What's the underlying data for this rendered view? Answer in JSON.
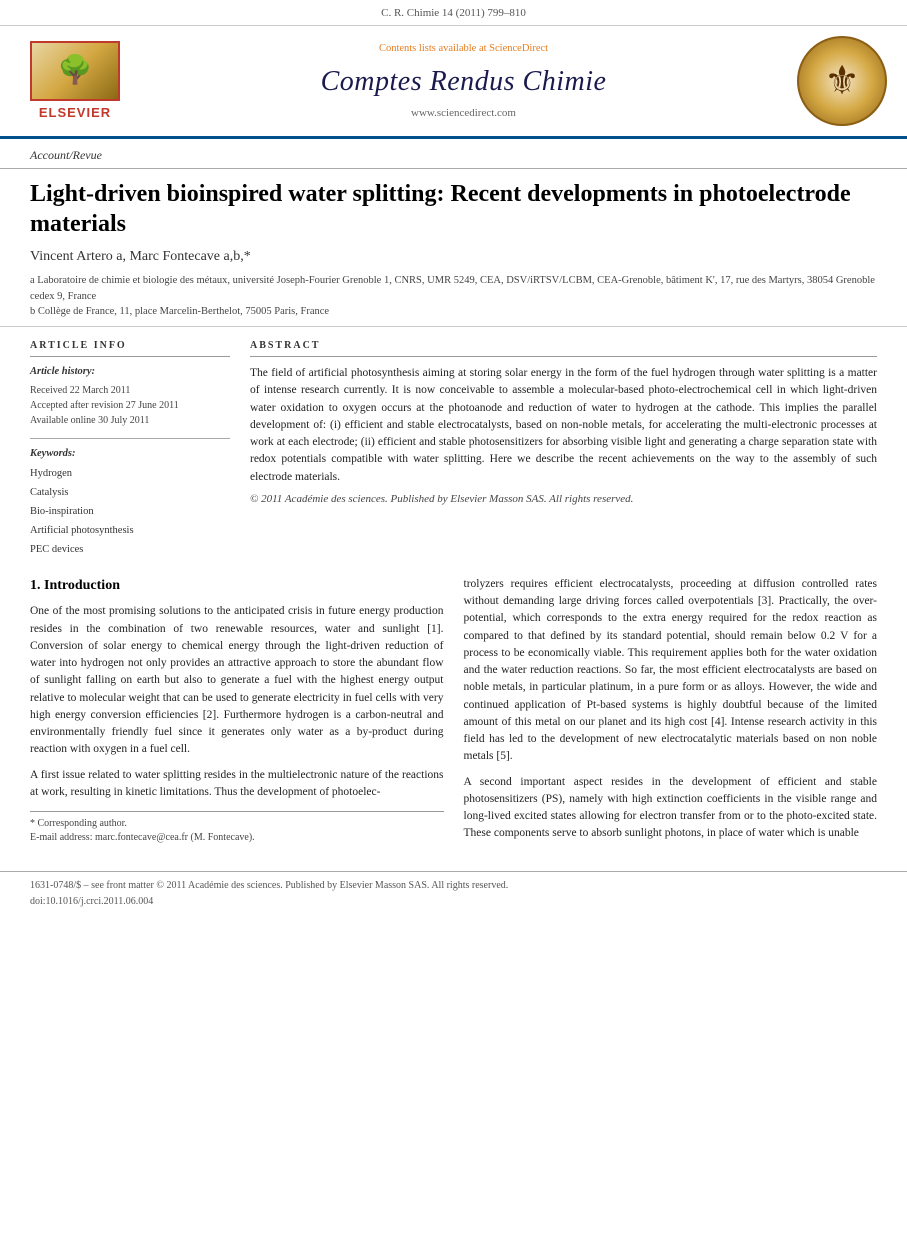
{
  "topbar": {
    "citation": "C. R. Chimie 14 (2011) 799–810"
  },
  "header": {
    "sciencedirect_prefix": "Contents lists available at ",
    "sciencedirect_link": "ScienceDirect",
    "journal_name": "Comptes Rendus Chimie",
    "journal_url": "www.sciencedirect.com"
  },
  "article": {
    "section_label": "Account/Revue",
    "title": "Light-driven bioinspired water splitting: Recent developments in photoelectrode materials",
    "authors": "Vincent Artero a, Marc Fontecave a,b,*",
    "affiliations": [
      "a Laboratoire de chimie et biologie des métaux, université Joseph-Fourier Grenoble 1, CNRS, UMR 5249, CEA, DSV/iRTSV/LCBM, CEA-Grenoble, bâtiment K', 17, rue des Martyrs, 38054 Grenoble cedex 9, France",
      "b Collège de France, 11, place Marcelin-Berthelot, 75005 Paris, France"
    ]
  },
  "article_info": {
    "section_label": "ARTICLE INFO",
    "history_label": "Article history:",
    "received": "Received 22 March 2011",
    "accepted": "Accepted after revision 27 June 2011",
    "available": "Available online 30 July 2011",
    "keywords_label": "Keywords:",
    "keywords": [
      "Hydrogen",
      "Catalysis",
      "Bio-inspiration",
      "Artificial photosynthesis",
      "PEC devices"
    ]
  },
  "abstract": {
    "section_label": "ABSTRACT",
    "text": "The field of artificial photosynthesis aiming at storing solar energy in the form of the fuel hydrogen through water splitting is a matter of intense research currently. It is now conceivable to assemble a molecular-based photo-electrochemical cell in which light-driven water oxidation to oxygen occurs at the photoanode and reduction of water to hydrogen at the cathode. This implies the parallel development of: (i) efficient and stable electrocatalysts, based on non-noble metals, for accelerating the multi-electronic processes at work at each electrode; (ii) efficient and stable photosensitizers for absorbing visible light and generating a charge separation state with redox potentials compatible with water splitting. Here we describe the recent achievements on the way to the assembly of such electrode materials.",
    "copyright": "© 2011 Académie des sciences. Published by Elsevier Masson SAS. All rights reserved."
  },
  "body": {
    "section1_title": "1. Introduction",
    "para1": "One of the most promising solutions to the anticipated crisis in future energy production resides in the combination of two renewable resources, water and sunlight [1]. Conversion of solar energy to chemical energy through the light-driven reduction of water into hydrogen not only provides an attractive approach to store the abundant flow of sunlight falling on earth but also to generate a fuel with the highest energy output relative to molecular weight that can be used to generate electricity in fuel cells with very high energy conversion efficiencies [2]. Furthermore hydrogen is a carbon-neutral and environmentally friendly fuel since it generates only water as a by-product during reaction with oxygen in a fuel cell.",
    "para2": "A first issue related to water splitting resides in the multielectronic nature of the reactions at work, resulting in kinetic limitations. Thus the development of photoelec-",
    "right_para1": "trolyzers requires efficient electrocatalysts, proceeding at diffusion controlled rates without demanding large driving forces called overpotentials [3]. Practically, the over-potential, which corresponds to the extra energy required for the redox reaction as compared to that defined by its standard potential, should remain below 0.2 V for a process to be economically viable. This requirement applies both for the water oxidation and the water reduction reactions. So far, the most efficient electrocatalysts are based on noble metals, in particular platinum, in a pure form or as alloys. However, the wide and continued application of Pt-based systems is highly doubtful because of the limited amount of this metal on our planet and its high cost [4]. Intense research activity in this field has led to the development of new electrocatalytic materials based on non noble metals [5].",
    "right_para2": "A second important aspect resides in the development of efficient and stable photosensitizers (PS), namely with high extinction coefficients in the visible range and long-lived excited states allowing for electron transfer from or to the photo-excited state. These components serve to absorb sunlight photons, in place of water which is unable"
  },
  "footnote": {
    "star_label": "* Corresponding author.",
    "email_label": "E-mail address: marc.fontecave@cea.fr (M. Fontecave)."
  },
  "bottom": {
    "issn": "1631-0748/$ – see front matter © 2011 Académie des sciences. Published by Elsevier Masson SAS. All rights reserved.",
    "doi": "doi:10.1016/j.crci.2011.06.004"
  }
}
